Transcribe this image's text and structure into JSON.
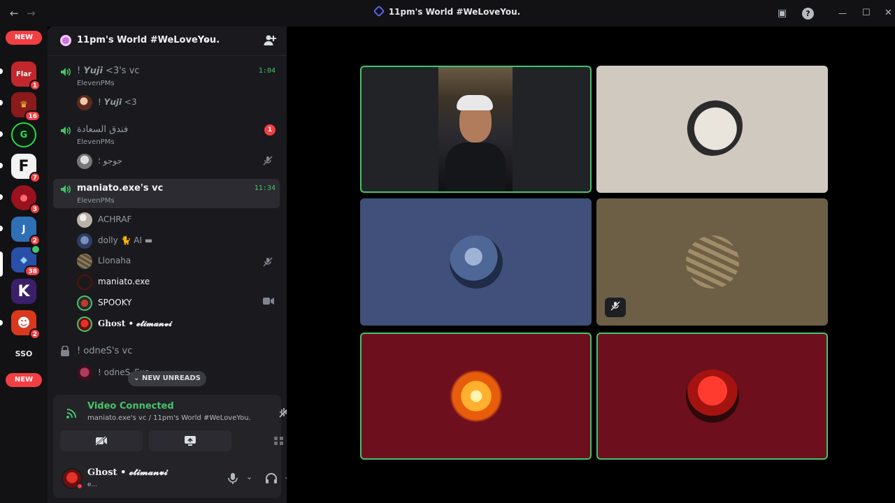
{
  "window": {
    "title": "11pm's World #WeLoveYou.",
    "back_icon": "←",
    "forward_icon": "→",
    "inbox_icon": "▣",
    "help_icon": "?",
    "minimize_icon": "—",
    "maximize_icon": "☐",
    "close_icon": "✕"
  },
  "rail": {
    "new_label_top": "NEW",
    "new_label_bottom": "NEW",
    "servers": [
      {
        "label": "Flar",
        "badge": "1",
        "color": "#c1272d"
      },
      {
        "label": "♛",
        "badge": "16",
        "color": "#8b1a1a"
      },
      {
        "label": "G",
        "badge": "",
        "color": "#0c1a12"
      },
      {
        "label": "F",
        "badge": "7",
        "color": "#f2f2f2"
      },
      {
        "label": "●",
        "badge": "3",
        "color": "#9b111e"
      },
      {
        "label": "J",
        "badge": "2",
        "color": "#2f6fb5"
      },
      {
        "label": "◆",
        "badge": "38",
        "color": "#2a4fa8"
      },
      {
        "label": "K",
        "badge": "",
        "color": "#3b1f6b"
      },
      {
        "label": "☻",
        "badge": "2",
        "color": "#d9381e"
      },
      {
        "label": "SSO",
        "badge": "",
        "color": "#121214"
      }
    ]
  },
  "server": {
    "name": "11pm's World #WeLoveYou.",
    "dropdown_icon": "⌄",
    "invite_icon": "person-add"
  },
  "channels": [
    {
      "name": "! 𝙔𝙪𝙟𝙞 <3's vc",
      "sub": "ElevenPMs",
      "time": "1:04"
    },
    {
      "name": "فندق السعادة",
      "sub": "ElevenPMs",
      "mention": "1"
    },
    {
      "name": "maniato.exe's vc",
      "sub": "ElevenPMs",
      "time": "11:34"
    },
    {
      "name": "! odneS's vc"
    }
  ],
  "members": {
    "yuji_channel": [
      {
        "name": "! 𝙔𝙪𝙟𝙞 <3"
      }
    ],
    "hotel_channel": [
      {
        "name": "جوجو ؛"
      }
    ],
    "maniato_channel": [
      {
        "name": "ACHRAF"
      },
      {
        "name": "dolly 🐈 AI ▬"
      },
      {
        "name": "Llonaha"
      },
      {
        "name": "maniato.exe"
      },
      {
        "name": "SPOOKY"
      },
      {
        "name": "Ghost • 𝓮𝓽𝓲𝓶𝓪𝓷𝓿𝓲"
      }
    ],
    "odnes_channel": [
      {
        "name": "! odneS_Exo..."
      }
    ]
  },
  "new_unreads": "⌄  NEW UNREADS",
  "voice": {
    "status": "Video Connected",
    "location": "maniato.exe's vc / 11pm's World #WeLoveYou."
  },
  "user": {
    "name": "Ghost • 𝓮𝓽𝓲𝓶𝓪𝓷𝓿𝓲",
    "status": "e..."
  },
  "tiles": [
    {
      "type": "video",
      "speaking": true,
      "bg": "#222327"
    },
    {
      "type": "avatar",
      "speaking": false,
      "bg": "#cfc9c0"
    },
    {
      "type": "avatar",
      "speaking": false,
      "bg": "#41507a"
    },
    {
      "type": "avatar",
      "speaking": false,
      "bg": "#6c5f46",
      "muted": true
    },
    {
      "type": "avatar",
      "speaking": true,
      "bg": "#6d0f1d"
    },
    {
      "type": "avatar",
      "speaking": true,
      "bg": "#6d0f1d"
    }
  ]
}
